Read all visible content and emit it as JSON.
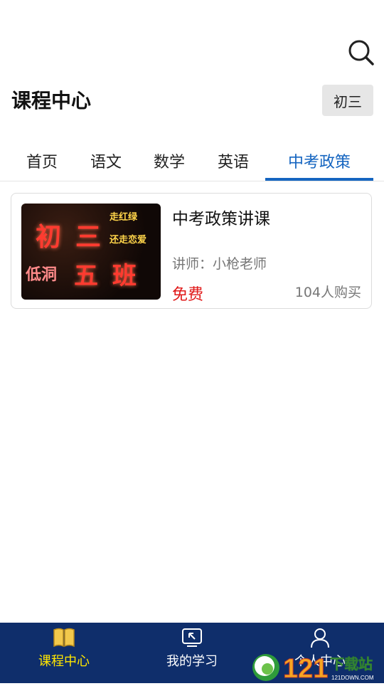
{
  "header": {
    "title": "课程中心",
    "grade": "初三",
    "search_icon": "search-icon"
  },
  "tabs": [
    {
      "label": "首页",
      "active": false
    },
    {
      "label": "语文",
      "active": false
    },
    {
      "label": "数学",
      "active": false
    },
    {
      "label": "英语",
      "active": false
    },
    {
      "label": "中考政策",
      "active": true
    }
  ],
  "courses": [
    {
      "title": "中考政策讲课",
      "teacher": "讲师：小枪老师",
      "price": "免费",
      "buyers": "104人购买",
      "thumbnail_text": [
        "初",
        "三",
        "走红绿",
        "还走恋爱",
        "低洞",
        "五",
        "班"
      ]
    }
  ],
  "bottom_nav": [
    {
      "label": "课程中心",
      "icon": "book-icon",
      "active": true
    },
    {
      "label": "我的学习",
      "icon": "study-icon",
      "active": false
    },
    {
      "label": "个人中心",
      "icon": "user-icon",
      "active": false
    }
  ],
  "watermark": {
    "text": "121下载站",
    "sub": "121DOWN.COM"
  },
  "colors": {
    "accent": "#1565c0",
    "nav_bg": "#0f2e6b",
    "active_nav": "#ffe600",
    "price": "#e01818"
  }
}
